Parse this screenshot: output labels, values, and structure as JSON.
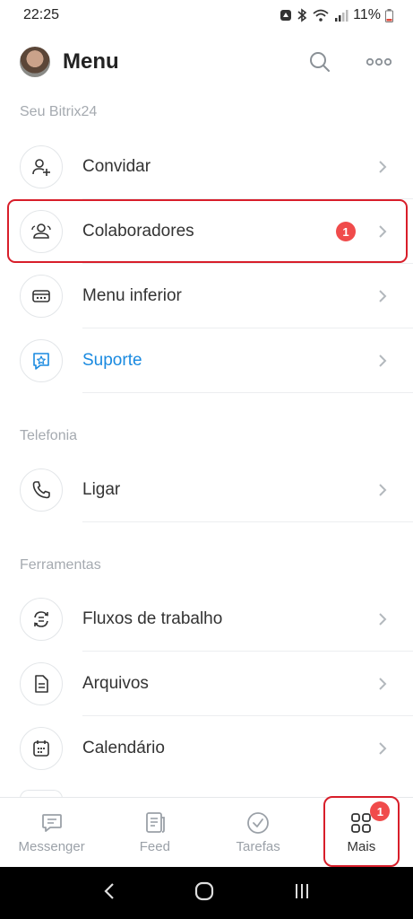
{
  "status_bar": {
    "time": "22:25",
    "battery": "11%"
  },
  "header": {
    "title": "Menu",
    "search_icon": "search-icon",
    "more_icon": "more-icon"
  },
  "sections": [
    {
      "title": "Seu Bitrix24"
    },
    {
      "title": "Telefonia"
    },
    {
      "title": "Ferramentas"
    }
  ],
  "items": {
    "convidar": {
      "label": "Convidar",
      "icon": "add-user-icon"
    },
    "colaboradores": {
      "label": "Colaboradores",
      "icon": "users-icon",
      "badge": "1"
    },
    "menu_inferior": {
      "label": "Menu inferior",
      "icon": "bottom-menu-icon"
    },
    "suporte": {
      "label": "Suporte",
      "icon": "support-icon",
      "color": "#1a8ae0"
    },
    "ligar": {
      "label": "Ligar",
      "icon": "phone-icon"
    },
    "fluxos": {
      "label": "Fluxos de trabalho",
      "icon": "workflow-icon"
    },
    "arquivos": {
      "label": "Arquivos",
      "icon": "file-icon"
    },
    "calendario": {
      "label": "Calendário",
      "icon": "calendar-icon"
    }
  },
  "bottom_nav": [
    {
      "label": "Messenger",
      "icon": "chat-icon"
    },
    {
      "label": "Feed",
      "icon": "feed-icon"
    },
    {
      "label": "Tarefas",
      "icon": "check-circle-icon"
    },
    {
      "label": "Mais",
      "icon": "grid-icon",
      "badge": "1",
      "active": true
    }
  ],
  "colors": {
    "accent": "#1a8ae0",
    "badge": "#f04b4b",
    "highlight": "#d81e2a"
  }
}
